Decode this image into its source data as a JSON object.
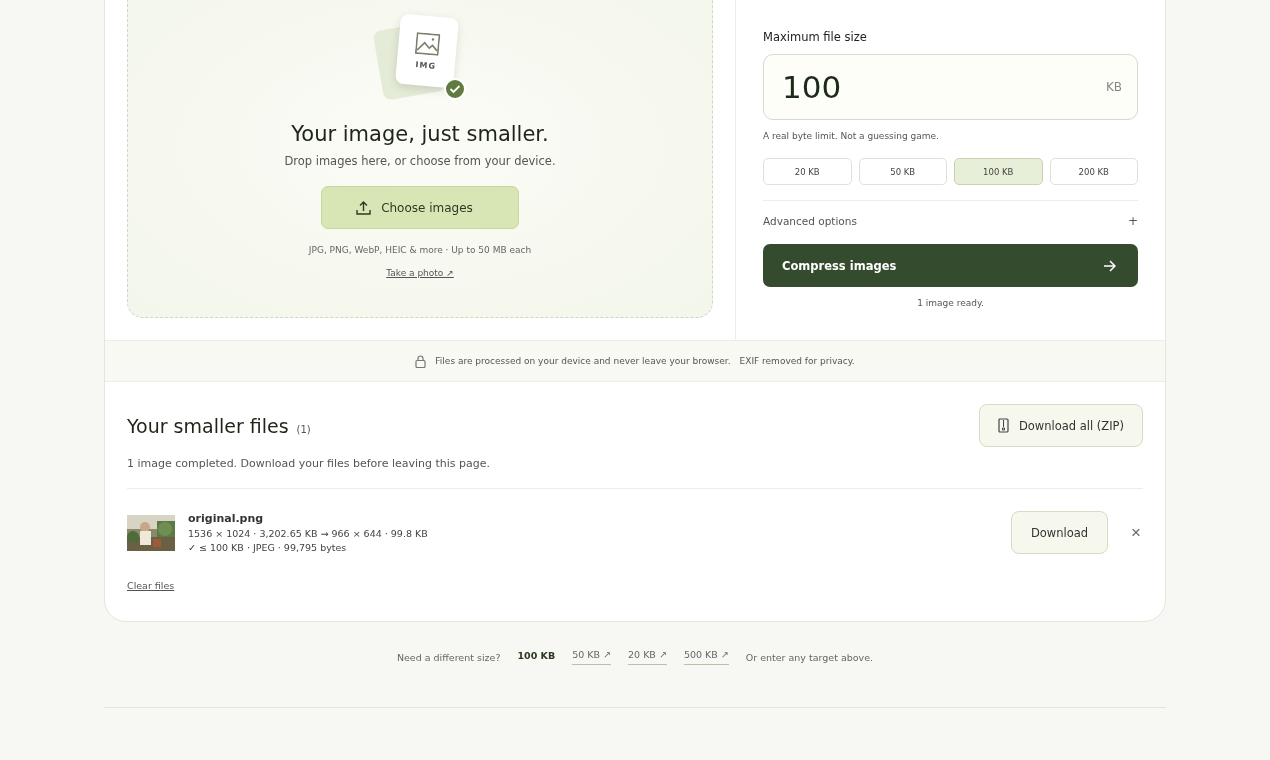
{
  "upload": {
    "badge": "IMG",
    "title": "Your image, just smaller.",
    "subtitle": "Drop images here, or choose from your device.",
    "button": "Choose images",
    "formats": "JPG, PNG, WebP, HEIC & more · Up to 50 MB each",
    "photo_link": "Take a photo ↗"
  },
  "limit": {
    "label": "Maximum file size",
    "value": "100",
    "unit": "KB",
    "hint": "A real byte limit. Not a guessing game.",
    "presets": [
      {
        "label": "20 KB",
        "selected": false
      },
      {
        "label": "50 KB",
        "selected": false
      },
      {
        "label": "100 KB",
        "selected": true
      },
      {
        "label": "200 KB",
        "selected": false
      }
    ],
    "advanced": {
      "label": "Advanced options",
      "toggle": "+"
    },
    "compress_button": "Compress images",
    "status": "1 image ready."
  },
  "privacy": {
    "text": "Files are processed on your device and never leave your browser.",
    "exif": "EXIF removed for privacy."
  },
  "results": {
    "title": "Your smaller files",
    "count": "(1)",
    "download_all": "Download all (ZIP)",
    "summary": "1 image completed. Download your files before leaving this page.",
    "files": [
      {
        "name": "original.png",
        "sizes": "1536 × 1024 · 3,202.65 KB → 966 × 644 · 99.8 KB",
        "result": "✓ ≤ 100 KB · JPEG · 99,795 bytes",
        "download": "Download",
        "remove": "×"
      }
    ],
    "clear": "Clear files"
  },
  "footer": {
    "prompt": "Need a different size?",
    "links": [
      {
        "label": "100 KB",
        "selected": true
      },
      {
        "label": "50 KB ↗",
        "selected": false
      },
      {
        "label": "20 KB ↗",
        "selected": false
      },
      {
        "label": "500 KB ↗",
        "selected": false
      }
    ],
    "note": "Or enter any target above."
  }
}
